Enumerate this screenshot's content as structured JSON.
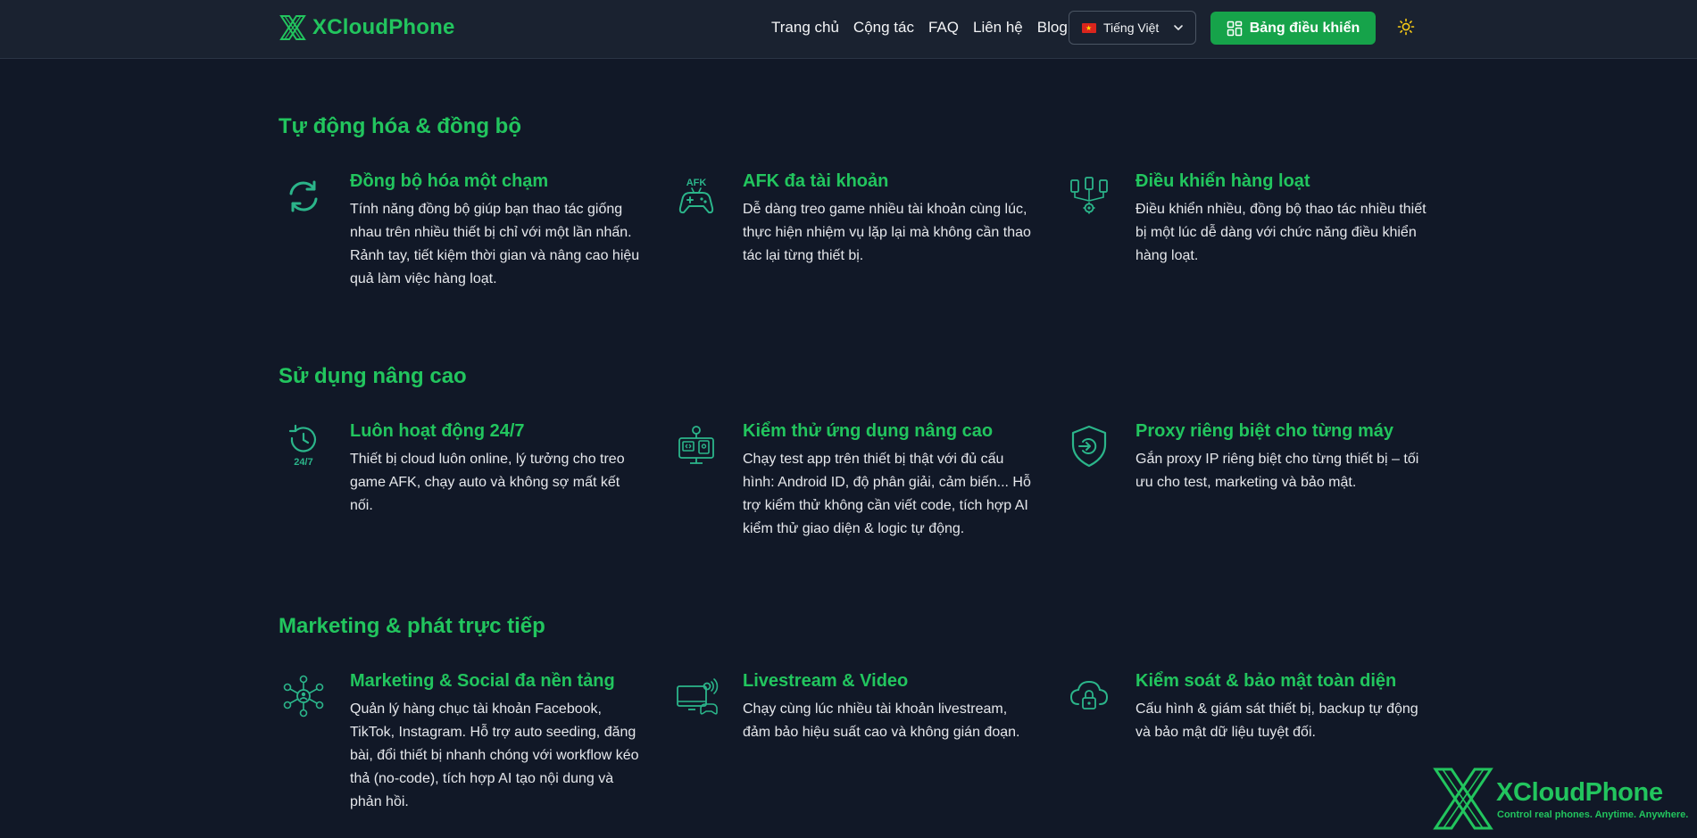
{
  "header": {
    "brand": "XCloudPhone",
    "nav": [
      "Trang chủ",
      "Cộng tác",
      "FAQ",
      "Liên hệ",
      "Blog"
    ],
    "language": "Tiếng Việt",
    "dashboard_label": "Bảng điều khiển"
  },
  "sections": [
    {
      "title": "Tự động hóa & đồng bộ",
      "features": [
        {
          "icon": "sync-icon",
          "title": "Đồng bộ hóa một chạm",
          "desc": "Tính năng đồng bộ giúp bạn thao tác giống nhau trên nhiều thiết bị chỉ với một lần nhấn. Rảnh tay, tiết kiệm thời gian và nâng cao hiệu quả làm việc hàng loạt."
        },
        {
          "icon": "afk-gamepad-icon",
          "title": "AFK đa tài khoản",
          "desc": "Dễ dàng treo game nhiều tài khoản cùng lúc, thực hiện nhiệm vụ lặp lại mà không cần thao tác lại từng thiết bị."
        },
        {
          "icon": "multi-device-control-icon",
          "title": "Điều khiển hàng loạt",
          "desc": "Điều khiển nhiều, đồng bộ thao tác nhiều thiết bị một lúc dễ dàng với chức năng điều khiển hàng loạt."
        }
      ]
    },
    {
      "title": "Sử dụng nâng cao",
      "features": [
        {
          "icon": "clock-24-7-icon",
          "icon_text": "24/7",
          "title": "Luôn hoạt động 24/7",
          "desc": "Thiết bị cloud luôn online, lý tưởng cho treo game AFK, chạy auto và không sợ mất kết nối."
        },
        {
          "icon": "app-testing-icon",
          "title": "Kiểm thử ứng dụng nâng cao",
          "desc": "Chạy test app trên thiết bị thật với đủ cấu hình: Android ID, độ phân giải, cảm biến... Hỗ trợ kiểm thử không cần viết code, tích hợp AI kiểm thử giao diện & logic tự động."
        },
        {
          "icon": "proxy-shield-icon",
          "title": "Proxy riêng biệt cho từng máy",
          "desc": "Gắn proxy IP riêng biệt cho từng thiết bị – tối ưu cho test, marketing và bảo mật."
        }
      ]
    },
    {
      "title": "Marketing & phát trực tiếp",
      "features": [
        {
          "icon": "social-network-icon",
          "title": "Marketing & Social đa nền tảng",
          "desc": "Quản lý hàng chục tài khoản Facebook, TikTok, Instagram. Hỗ trợ auto seeding, đăng bài, đổi thiết bị nhanh chóng với workflow kéo thả (no-code), tích hợp AI tạo nội dung và phản hồi."
        },
        {
          "icon": "livestream-icon",
          "title": "Livestream & Video",
          "desc": "Chạy cùng lúc nhiều tài khoản livestream, đảm bảo hiệu suất cao và không gián đoạn."
        },
        {
          "icon": "cloud-lock-icon",
          "title": "Kiểm soát & bảo mật toàn diện",
          "desc": "Cấu hình & giám sát thiết bị, backup tự động và bảo mật dữ liệu tuyệt đối."
        }
      ]
    }
  ],
  "watermark": {
    "brand": "XCloudPhone",
    "tagline": "Control real phones. Anytime. Anywhere."
  },
  "colors": {
    "background": "#111827",
    "header": "#1a2230",
    "accent": "#22c55e",
    "button": "#16a34a",
    "icon": "#2bb58a"
  }
}
